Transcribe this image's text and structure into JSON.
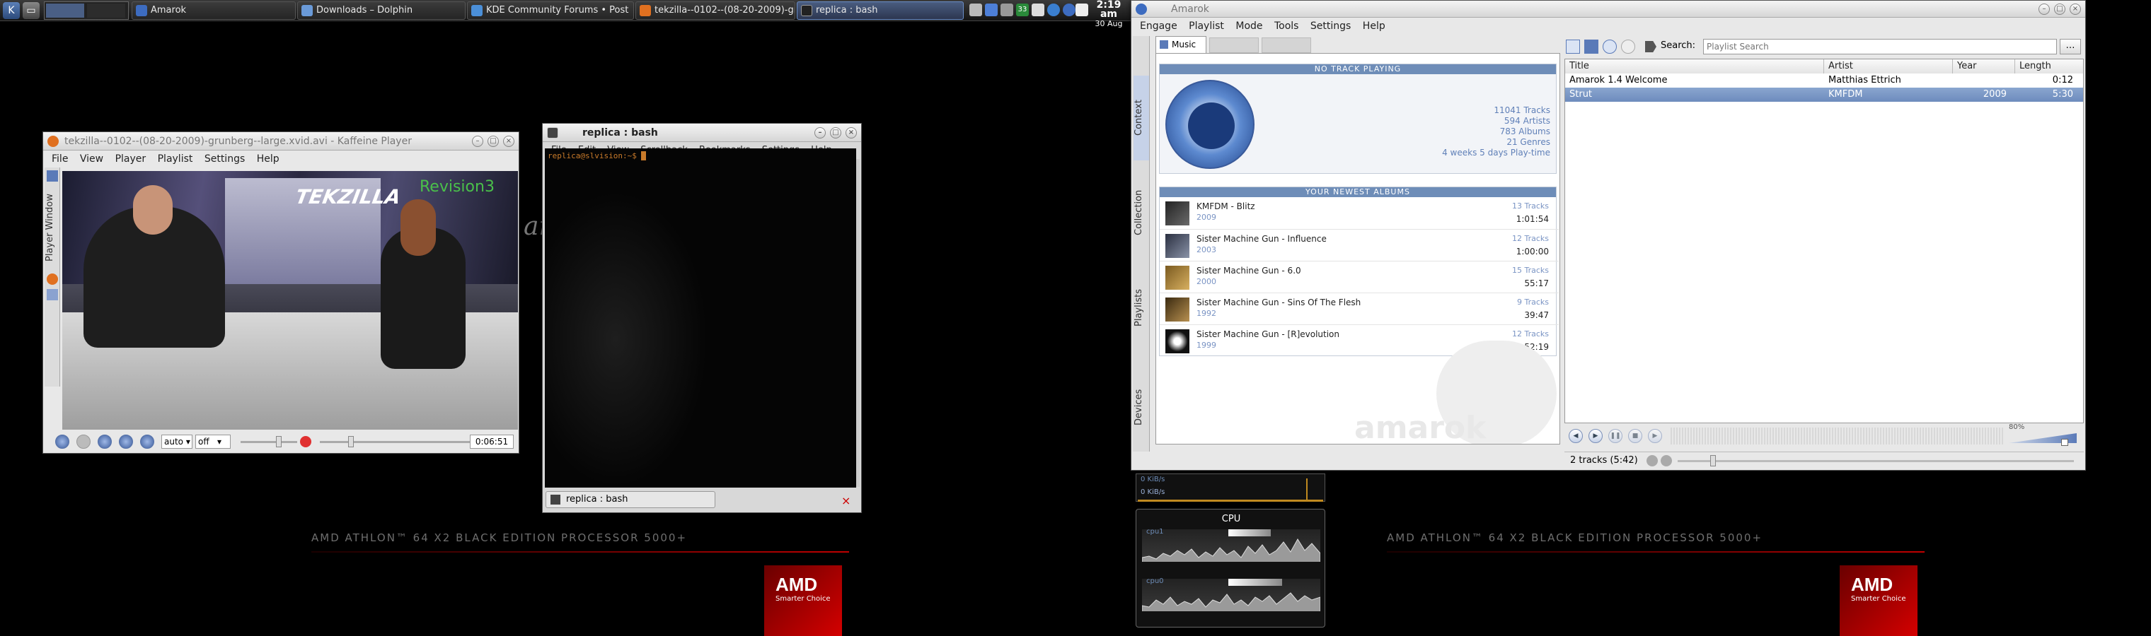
{
  "taskbar": {
    "tasks": [
      {
        "label": "Amarok"
      },
      {
        "label": "Downloads – Dolphin"
      },
      {
        "label": "KDE Community Forums • Post"
      },
      {
        "label": "tekzilla--0102--(08-20-2009)-gru"
      },
      {
        "label": "replica : bash"
      }
    ],
    "clock_time": "2:19 am",
    "clock_date": "30 Aug"
  },
  "desktop": {
    "processor_text": "AMD ATHLON™ 64 X2 BLACK EDITION PROCESSOR 5000+",
    "amd_logo": "AMD",
    "amd_tagline": "Smarter Choice",
    "bg_text": "are?"
  },
  "kaffeine": {
    "title": "tekzilla--0102--(08-20-2009)-grunberg--large.xvid.avi - Kaffeine Player",
    "menu": [
      "File",
      "View",
      "Player",
      "Playlist",
      "Settings",
      "Help"
    ],
    "side_tab": "Player Window",
    "overlay_text": "Revision3",
    "aspect_value": "auto",
    "deint_value": "off",
    "time": "0:06:51"
  },
  "terminal": {
    "title": "replica : bash",
    "menu": [
      "File",
      "Edit",
      "View",
      "Scrollback",
      "Bookmarks",
      "Settings",
      "Help"
    ],
    "prompt": "replica@slvision:~$ ",
    "tab_label": "replica : bash"
  },
  "amarok": {
    "title": "Amarok",
    "menu": [
      "Engage",
      "Playlist",
      "Mode",
      "Tools",
      "Settings",
      "Help"
    ],
    "tabs": {
      "music": "Music"
    },
    "side_tabs": [
      "Context",
      "Collection",
      "Playlists",
      "Devices"
    ],
    "no_track": "NO TRACK PLAYING",
    "stats": [
      "11041 Tracks",
      "594 Artists",
      "783 Albums",
      "21 Genres",
      "4 weeks 5 days Play-time"
    ],
    "newest_header": "YOUR NEWEST ALBUMS",
    "albums": [
      {
        "title": "KMFDM - Blitz",
        "year": "2009",
        "tracks": "13 Tracks",
        "duration": "1:01:54"
      },
      {
        "title": "Sister Machine Gun - Influence",
        "year": "2003",
        "tracks": "12 Tracks",
        "duration": "1:00:00"
      },
      {
        "title": "Sister Machine Gun - 6.0",
        "year": "2000",
        "tracks": "15 Tracks",
        "duration": "55:17"
      },
      {
        "title": "Sister Machine Gun - Sins Of The Flesh",
        "year": "1992",
        "tracks": "9 Tracks",
        "duration": "39:47"
      },
      {
        "title": "Sister Machine Gun - [R]evolution",
        "year": "1999",
        "tracks": "12 Tracks",
        "duration": "52:19"
      }
    ],
    "watermark": "amarok",
    "search_label": "Search:",
    "search_placeholder": "Playlist Search",
    "columns": [
      "Title",
      "Artist",
      "Year",
      "Length"
    ],
    "rows": [
      {
        "title": "Amarok 1.4 Welcome",
        "artist": "Matthias Ettrich",
        "year": "",
        "length": "0:12"
      },
      {
        "title": "Strut",
        "artist": "KMFDM",
        "year": "2009",
        "length": "5:30"
      }
    ],
    "volume": "80%",
    "status": "2 tracks (5:42)"
  },
  "system_monitor": {
    "net_rate_1": "0 KiB/s",
    "net_rate_2": "0 KiB/s",
    "cpu_title": "CPU",
    "cpu1_label": "cpu1",
    "cpu0_label": "cpu0"
  },
  "colors": {
    "amarok_accent": "#6e8db8",
    "selection": "#7d9bc6",
    "amd_red": "#c00000",
    "terminal_prompt": "#c87a2a"
  }
}
